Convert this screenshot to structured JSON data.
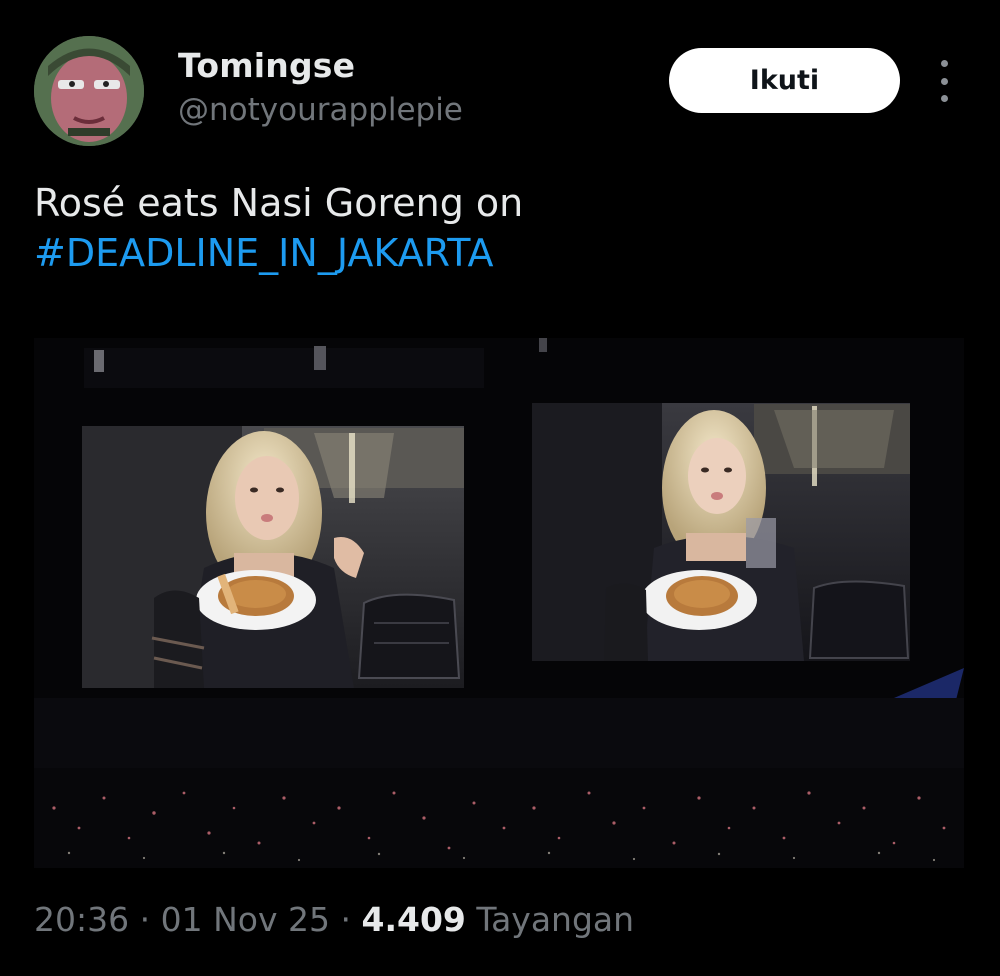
{
  "user": {
    "display_name": "Tomingse",
    "handle": "@notyourapplepie",
    "avatar_icon": "profile-avatar"
  },
  "actions": {
    "follow_label": "Ikuti",
    "more_icon": "more-vertical-icon"
  },
  "tweet": {
    "text": "Rosé eats Nasi Goreng on",
    "hashtag": "#DEADLINE_IN_JAKARTA"
  },
  "media": {
    "description_icon": "concert-photo"
  },
  "meta": {
    "time": "20:36",
    "separator": "·",
    "date": "01 Nov 25",
    "views_count": "4.409",
    "views_label": "Tayangan"
  },
  "colors": {
    "background": "#000000",
    "text": "#e7e9ea",
    "secondary": "#71767b",
    "link": "#1d9bf0",
    "button_bg": "#ffffff",
    "button_text": "#0f1419"
  }
}
